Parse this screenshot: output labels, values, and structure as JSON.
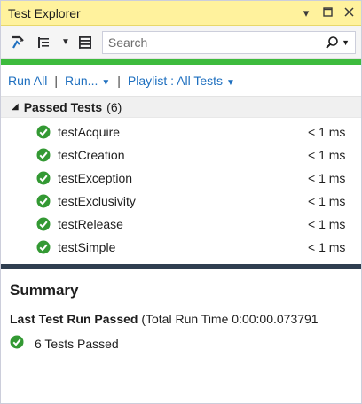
{
  "window": {
    "title": "Test Explorer",
    "pin_icon": "pin-dropdown-icon",
    "maximize_icon": "maximize-icon",
    "close_icon": "close-icon"
  },
  "toolbar": {
    "search_placeholder": "Search",
    "icons": [
      "run-settings-icon",
      "group-by-icon",
      "dropdown-icon",
      "list-icon",
      "search-icon"
    ]
  },
  "actions": {
    "run_all": "Run All",
    "run": "Run...",
    "playlist": "Playlist : All Tests"
  },
  "group": {
    "label": "Passed Tests",
    "count": "(6)"
  },
  "tests": [
    {
      "name": "testAcquire",
      "duration": "< 1 ms"
    },
    {
      "name": "testCreation",
      "duration": "< 1 ms"
    },
    {
      "name": "testException",
      "duration": "< 1 ms"
    },
    {
      "name": "testExclusivity",
      "duration": "< 1 ms"
    },
    {
      "name": "testRelease",
      "duration": "< 1 ms"
    },
    {
      "name": "testSimple",
      "duration": "< 1 ms"
    }
  ],
  "summary": {
    "heading": "Summary",
    "last_run_label": "Last Test Run Passed",
    "last_run_detail": "(Total Run Time 0:00:00.073791",
    "passed_text": "6 Tests Passed"
  },
  "colors": {
    "title_bg": "#fff29d",
    "status_green": "#3dbb3d",
    "link_blue": "#1e6fbf",
    "check_green": "#339933",
    "splitter": "#2f3e50"
  }
}
